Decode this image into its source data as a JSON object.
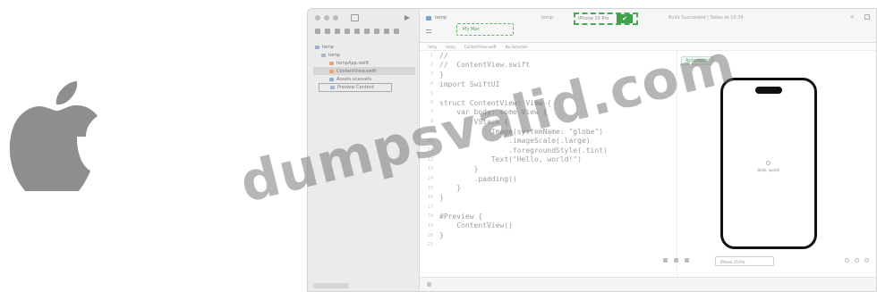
{
  "brand": {
    "logo_icon": "apple-logo-icon",
    "logo_color": "#8e8e8e"
  },
  "sidebar": {
    "items": [
      {
        "label": "temp",
        "icon": "project-icon"
      },
      {
        "label": "temp",
        "icon": "folder-icon"
      },
      {
        "label": "tempApp.swift",
        "icon": "swift-file-icon"
      },
      {
        "label": "ContentView.swift",
        "icon": "swift-file-icon"
      },
      {
        "label": "Assets.xcassets",
        "icon": "assets-icon"
      },
      {
        "label": "Preview Content",
        "icon": "folder-icon"
      }
    ]
  },
  "toolbar": {
    "project": "temp",
    "run_destination": "My Mac",
    "scheme_name": "temp",
    "scheme_destination": "iPhone 15 Pro",
    "build_status": "Build Succeeded | Today at 10:34",
    "accent": "#3fa34c"
  },
  "breadcrumbs": [
    "temp",
    "temp",
    "ContentView.swift",
    "No Selection"
  ],
  "editor": {
    "lines": [
      {
        "n": "1",
        "text": "//"
      },
      {
        "n": "2",
        "text": "//  ContentView.swift"
      },
      {
        "n": "3",
        "text": "}"
      },
      {
        "n": "4",
        "text": "import SwiftUI"
      },
      {
        "n": "5",
        "text": ""
      },
      {
        "n": "6",
        "text": "struct ContentView: View {"
      },
      {
        "n": "7",
        "text": "    var body: some View {"
      },
      {
        "n": "8",
        "text": "        VStack {"
      },
      {
        "n": "9",
        "text": "            Image(systemName: \"globe\")"
      },
      {
        "n": "10",
        "text": "                .imageScale(.large)"
      },
      {
        "n": "11",
        "text": "                .foregroundStyle(.tint)"
      },
      {
        "n": "12",
        "text": "            Text(\"Hello, world!\")"
      },
      {
        "n": "13",
        "text": "        }"
      },
      {
        "n": "14",
        "text": "        .padding()"
      },
      {
        "n": "15",
        "text": "    }"
      },
      {
        "n": "16",
        "text": "}"
      },
      {
        "n": "17",
        "text": ""
      },
      {
        "n": "18",
        "text": "#Preview {"
      },
      {
        "n": "19",
        "text": "    ContentView()"
      },
      {
        "n": "20",
        "text": "}"
      },
      {
        "n": "21",
        "text": ""
      }
    ]
  },
  "canvas": {
    "chip": "Automatic",
    "phone_text": "Hello, world!",
    "device_select": "iPhone 15 Pro"
  },
  "watermark": "dumpsvalid.com"
}
